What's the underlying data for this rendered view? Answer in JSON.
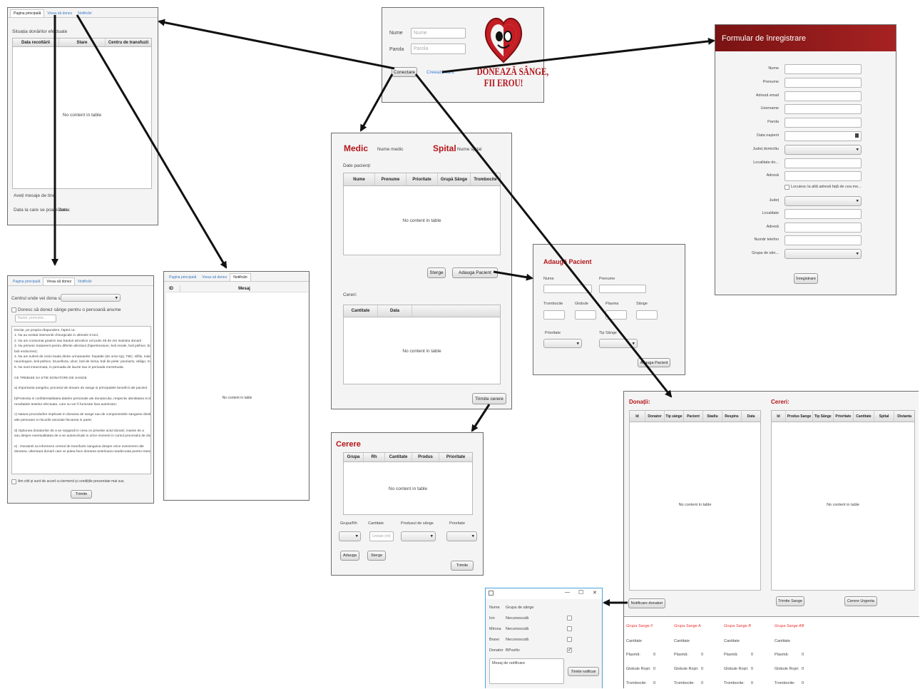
{
  "login": {
    "name_label": "Nume",
    "name_ph": "Nume",
    "pass_label": "Parola",
    "pass_ph": "Parola",
    "connect": "Conectare",
    "create": "Creează cont",
    "logo_line1": "DONEAZĂ SÂNGE,",
    "logo_line2": "FII EROU!"
  },
  "register": {
    "title": "Formular de înregistrare",
    "fields": [
      "Nume",
      "Prenume",
      "Adresă email",
      "Username",
      "Parola",
      "Data nașterii",
      "Județ domiciliu",
      "Localitate do...",
      "Adresă"
    ],
    "checkbox": "Locuiesc la altă adresă față de cea me...",
    "fields2": [
      "Județ",
      "Localitate",
      "Adresă",
      "Număr telefon",
      "Grupa de sân..."
    ],
    "submit": "Înregistrare",
    "colors": {
      "header": "#8e1818"
    }
  },
  "donor_home": {
    "tabs": [
      "Pagina principală",
      "Vreau să donez",
      "Notificări"
    ],
    "section": "Situația donărilor efectuate",
    "columns": [
      "Data recoltării",
      "Stare",
      "Centru de transfuzii"
    ],
    "empty": "No content in table",
    "msg": "Aveți mesaje de tine",
    "date_label": "Data la care se poate dona:",
    "date_value": "Data"
  },
  "donate": {
    "tabs": [
      "Pagina principală",
      "Vreau să donez",
      "Notificări"
    ],
    "center_label": "Centrul unde vei dona sânge:",
    "for_person": "Doresc să donez sânge pentru o persoană anume",
    "person_ph": "Nume, prenume...",
    "lines": [
      "Declar, pe propria răspundere, faptul ca:",
      "1. Nu au existat interventii chirurgicale in ultimele 6 luni;",
      "2. Nu am consumat grasimi sau bauturi alcoolice cel putin 48 de ore inaintea donarii",
      "3. Nu primesc tratament pentru diferite afectiuni (hipertensiune, boli renale, boli psihice, boli a",
      "boli endocrine);",
      "4. Nu am suferit de niciio boala dintre urmatoarele: hepatite (de orice tip), TBC, sifilis, malarie, e",
      "neurologice, boli psihice, bruxelloza, ulcer, boli de inima, boli de piele: psoriazis, vitiligo, mioza",
      "5. Nu sunt insarcinata, in perioada de lauzie sau in perioada menstruala.",
      "",
      "CE TREBUIE SA STIE DONATORII DE SANGE",
      "",
      "a) Importanta sangelui, procesul de donare de sange si principalele beneficii ale pacient",
      "",
      "b)Protectia si confidentialitatea datelor personale ale donatorului, respectiv identitatea si stare",
      "rezultatele testelor efectuate, care nu vor fi furnizate fara autorizare;",
      "",
      "c) Natura procedurilor implicate in donarea de sange sau de componentele sanguine destinate",
      "alte persoane si riscurile asociate fiecareia in parte;",
      "",
      "d) Optiunea donatorilor de a se razgandi in ceea ce priveste actul donarii, inainte de a",
      "sau despre eventualitatea de a se autoexclude in orice moment in cursul procesului de donare",
      "",
      "e) . Donatorii sa informeze centrul de transfuzie sanguina despre orice eveniment ulte",
      "donarea, ulterioara donarii care ar putea face donarea anterioara neadecvata pentru transfuzie"
    ],
    "agree": "Am citit și sunt de acord cu termenii și condițiile prezentate mai sus.",
    "send": "Trimite"
  },
  "notif": {
    "tabs": [
      "Pagina principală",
      "Vreau să donez",
      "Notificări"
    ],
    "columns": [
      "ID",
      "Mesaj"
    ],
    "empty": "No content in table"
  },
  "medic": {
    "medic_title": "Medic",
    "medic_name": "Nume medic",
    "spital_title": "Spital",
    "spital_name": "Nume spital",
    "patients_label": "Date pacienți",
    "columns": [
      "Nume",
      "Prenume",
      "Prioritate",
      "Grupă Sânge",
      "Trombocite"
    ],
    "empty": "No content in table",
    "delete": "Sterge",
    "add": "Adauga Pacient",
    "requests_label": "Cereri:",
    "req_columns": [
      "Cantitate",
      "Data"
    ],
    "req_empty": "No content in table",
    "send": "Trimite cerere"
  },
  "add_patient": {
    "title": "Adaugă Pacient",
    "name": "Nume",
    "surname": "Prenume",
    "labels": [
      "Trombocite",
      "Globule",
      "Plasma",
      "Sânge"
    ],
    "priority": "Prioritate",
    "blood_type": "Tip Sânge",
    "submit": "Adauga Pacient"
  },
  "request": {
    "title": "Cerere",
    "columns": [
      "Grupa",
      "Rh",
      "Cantitate",
      "Produs",
      "Prioritate"
    ],
    "empty": "No content in table",
    "labels": [
      "Grupa/Rh",
      "Cantitate",
      "Produsul de sânge",
      "Prioritate"
    ],
    "qty_ph": "Unitate (ml)",
    "add": "Adauga",
    "delete": "Sterge",
    "send": "Trimite"
  },
  "center": {
    "don_title": "Donații:",
    "don_columns": [
      "Id",
      "Donator",
      "Tip sânge",
      "Pacient",
      "Stadiu",
      "Respins",
      "Data"
    ],
    "don_empty": "No content in table",
    "req_title": "Cereri:",
    "req_columns": [
      "Id",
      "Produs Sange",
      "Tip Sânge",
      "Prioritate",
      "Cantitate",
      "Spital",
      "Distanta"
    ],
    "req_empty": "No content in table",
    "notify": "Notificare donatori",
    "send_blood": "Trimite Sange",
    "urgent": "Cerere Urgenta",
    "groups": [
      {
        "name": "Grupa Sange 0",
        "qty": "Cantitate",
        "plasma": "0",
        "red": "0",
        "trombo": "0"
      },
      {
        "name": "Grupa Sange A",
        "qty": "Cantitate",
        "plasma": "0",
        "red": "0",
        "trombo": "0"
      },
      {
        "name": "Grupa Sange B",
        "qty": "Cantitate",
        "plasma": "0",
        "red": "0",
        "trombo": "0"
      },
      {
        "name": "Grupa Sange AB",
        "qty": "Cantitate",
        "plasma": "0",
        "red": "0",
        "trombo": "0"
      }
    ],
    "row_labels": [
      "Plasmă:",
      "Globule Roșii:",
      "Trombocite:"
    ]
  },
  "notify_win": {
    "min": "—",
    "max": "☐",
    "close": "✕",
    "h_name": "Nume",
    "h_group": "Grupa de sânge",
    "rows": [
      {
        "name": "Ion",
        "group": "Necunoscută",
        "checked": false
      },
      {
        "name": "Mircea",
        "group": "Necunoscută",
        "checked": false
      },
      {
        "name": "Bravo",
        "group": "Necunoscută",
        "checked": false
      },
      {
        "name": "Donator",
        "group": "BPozitiv",
        "checked": true
      }
    ],
    "msg_ph": "Mesaj de notificare",
    "send": "Trimite notificari"
  }
}
